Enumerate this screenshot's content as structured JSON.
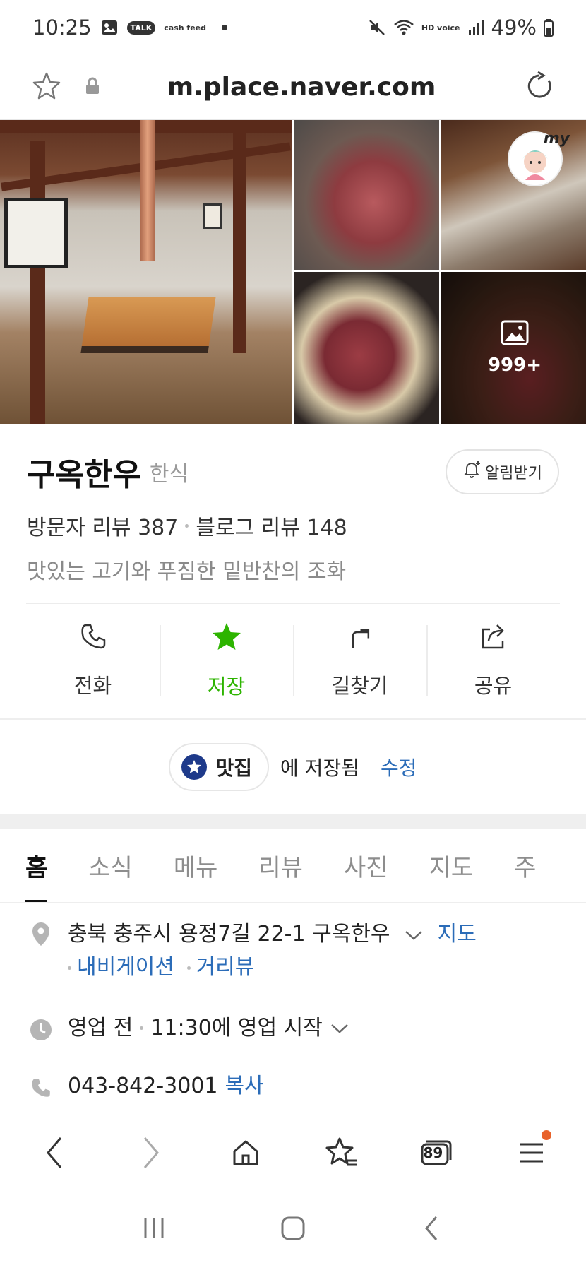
{
  "status_bar": {
    "time": "10:25",
    "talk_badge": "TALK",
    "cash_feed": "cash feed",
    "hd_voice": "HD voice",
    "battery": "49%"
  },
  "browser": {
    "url": "m.place.naver.com"
  },
  "photos": {
    "more_count": "999+",
    "avatar_label": "my"
  },
  "place": {
    "name": "구옥한우",
    "category": "한식",
    "alarm_label": "알림받기",
    "visitor_reviews": "방문자 리뷰 387",
    "blog_reviews": "블로그 리뷰 148",
    "description": "맛있는 고기와 푸짐한 밑반찬의 조화"
  },
  "actions": [
    {
      "label": "전화",
      "icon": "phone-icon"
    },
    {
      "label": "저장",
      "icon": "star-icon"
    },
    {
      "label": "길찾기",
      "icon": "directions-icon"
    },
    {
      "label": "공유",
      "icon": "share-icon"
    }
  ],
  "saved": {
    "folder": "맛집",
    "status_text": "에 저장됨",
    "edit_label": "수정"
  },
  "tabs": [
    "홈",
    "소식",
    "메뉴",
    "리뷰",
    "사진",
    "지도",
    "주"
  ],
  "info": {
    "address": "충북 충주시 용정7길 22-1 구옥한우",
    "map_link": "지도",
    "navigation_link": "내비게이션",
    "street_view_link": "거리뷰",
    "hours_status": "영업 전",
    "hours_detail": "11:30에 영업 시작",
    "phone": "043-842-3001",
    "copy_link": "복사"
  },
  "toolbar": {
    "tab_count": "89"
  },
  "colors": {
    "accent_green": "#2db400",
    "link_blue": "#2b6cb8",
    "chip_navy": "#1e3a8a",
    "notification": "#e8622a"
  }
}
